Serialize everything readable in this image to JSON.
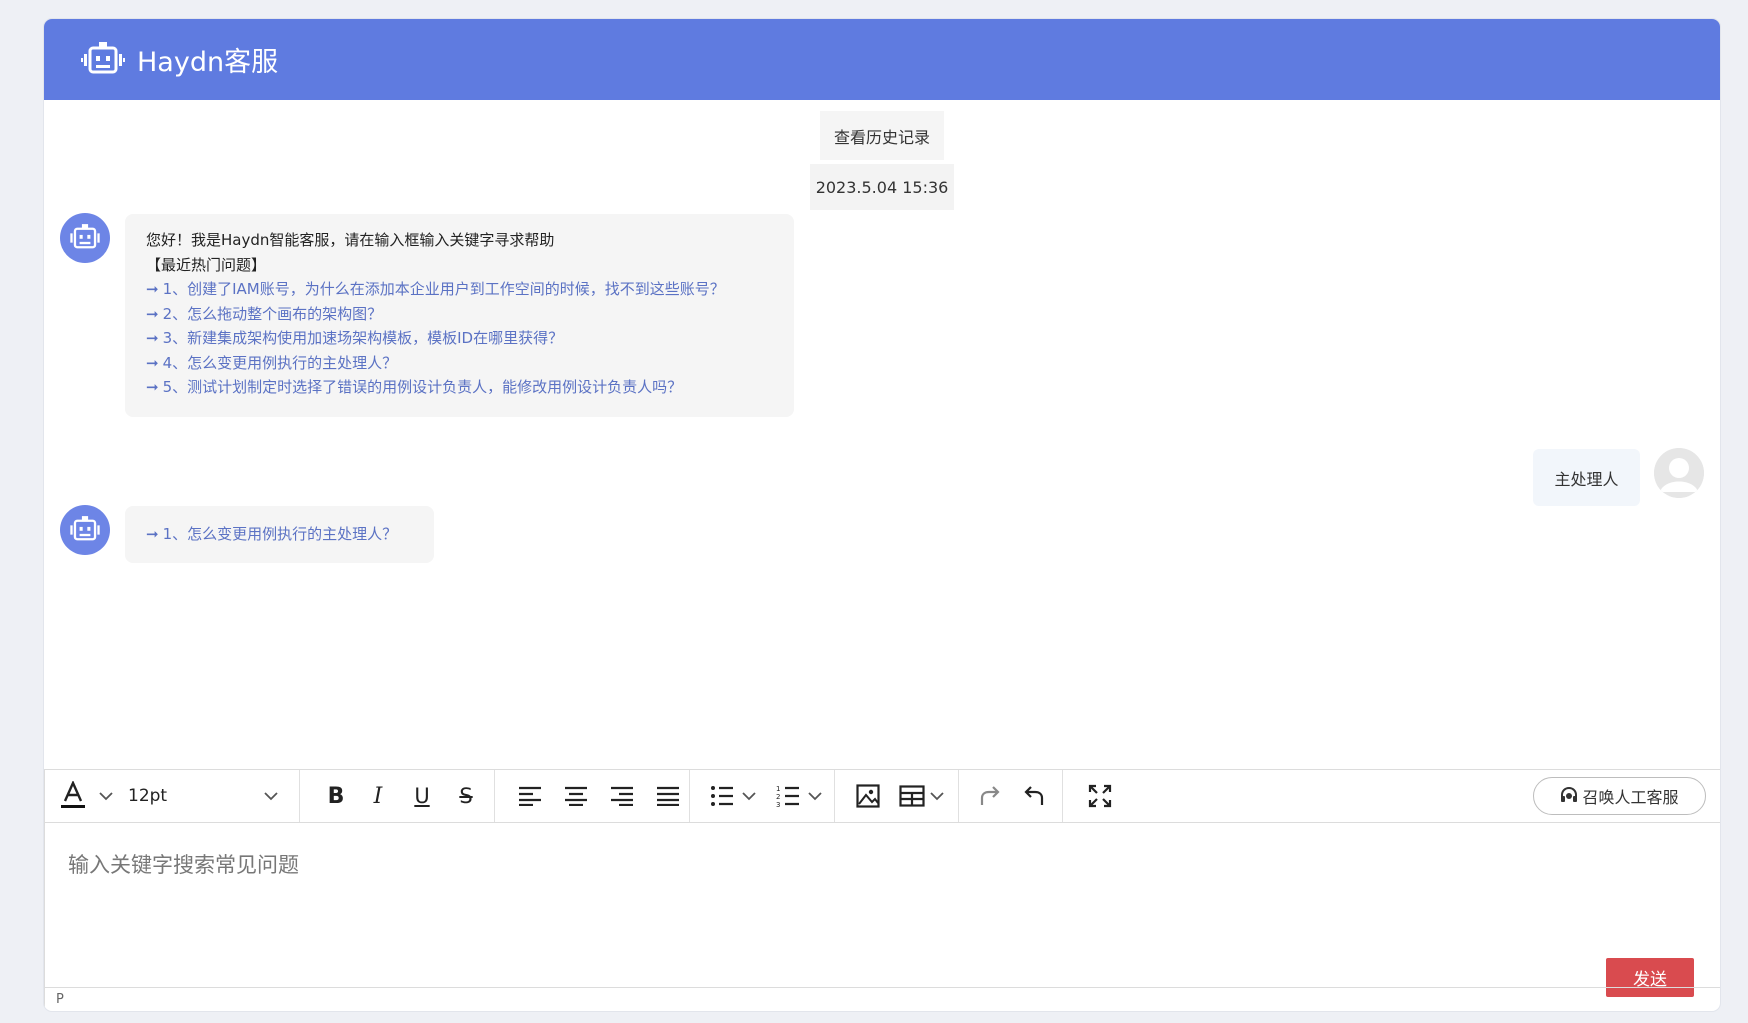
{
  "header": {
    "title": "Haydn客服"
  },
  "chat": {
    "history_button": "查看历史记录",
    "timestamp": "2023.5.04 15:36",
    "welcome": {
      "greeting": "您好！我是Haydn智能客服，请在输入框输入关键字寻求帮助",
      "section_title": "【最近热门问题】",
      "questions": [
        "1、创建了IAM账号，为什么在添加本企业用户到工作空间的时候，找不到这些账号？",
        "2、怎么拖动整个画布的架构图？",
        "3、新建集成架构使用加速场架构模板，模板ID在哪里获得？",
        "4、怎么变更用例执行的主处理人？",
        "5、测试计划制定时选择了错误的用例设计负责人，能修改用例设计负责人吗？"
      ]
    },
    "user_message": "主处理人",
    "reply": {
      "questions": [
        "1、怎么变更用例执行的主处理人？"
      ]
    }
  },
  "toolbar": {
    "font_size": "12pt",
    "manual_service": "召唤人工客服",
    "icons": [
      "font-color-icon",
      "bold-icon",
      "italic-icon",
      "underline-icon",
      "strikethrough-icon",
      "align-left-icon",
      "align-center-icon",
      "align-right-icon",
      "align-justify-icon",
      "bullet-list-icon",
      "numbered-list-icon",
      "image-icon",
      "table-icon",
      "redo-icon",
      "undo-icon",
      "fullscreen-icon"
    ]
  },
  "editor": {
    "placeholder": "输入关键字搜索常见问题",
    "send": "发送",
    "status_path": "P"
  },
  "colors": {
    "header": "#5f7be0",
    "link": "#5b72c4",
    "send": "#d94b4f"
  }
}
